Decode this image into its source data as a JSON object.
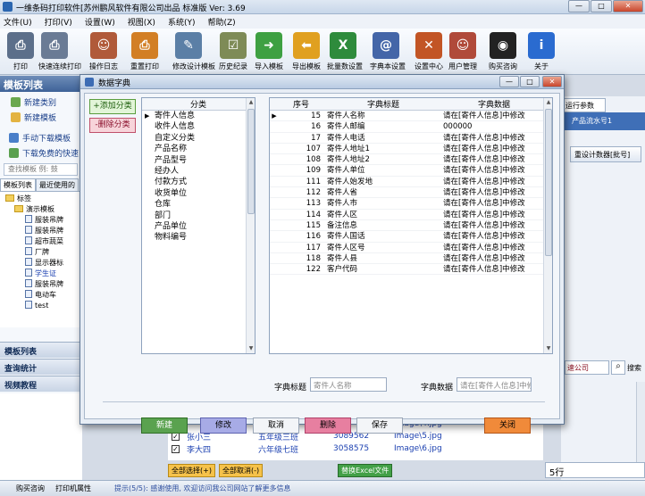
{
  "window": {
    "title": "一维条码打印软件[苏州鹏风软件有限公司出品 标准版 Ver: 3.69"
  },
  "menu": [
    "文件(U)",
    "打印(V)",
    "设置(W)",
    "视图(X)",
    "系统(Y)",
    "帮助(Z)"
  ],
  "toolbar": [
    {
      "label": "打印",
      "icon": "printer-icon",
      "color": "#5c6f8a"
    },
    {
      "label": "快速连续打印",
      "icon": "fast-print-icon",
      "color": "#6a7b95"
    },
    {
      "label": "操作日志",
      "icon": "users-log-icon",
      "color": "#b05a3a"
    },
    {
      "label": "重置打印",
      "icon": "reset-print-icon",
      "color": "#d27f25"
    },
    {
      "label": "修改设计模板",
      "icon": "design-tools-icon",
      "color": "#5b7fa6"
    },
    {
      "label": "历史纪录",
      "icon": "clipboard-history-icon",
      "color": "#7e8b57"
    },
    {
      "label": "导入模板",
      "icon": "import-arrow-icon",
      "color": "#3ea042"
    },
    {
      "label": "导出模板",
      "icon": "export-arrow-icon",
      "color": "#e0a020"
    },
    {
      "label": "批量数设置",
      "icon": "excel-icon",
      "color": "#2e8b3c"
    },
    {
      "label": "字典本设置",
      "icon": "address-book-icon",
      "color": "#4466a8"
    },
    {
      "label": "设置中心",
      "icon": "tools-icon",
      "color": "#c25525"
    },
    {
      "label": "用户管理",
      "icon": "user-manage-icon",
      "color": "#b04a3a"
    },
    {
      "label": "购买咨询",
      "icon": "qq-penguin-icon",
      "color": "#222222"
    },
    {
      "label": "关于",
      "icon": "info-icon",
      "color": "#2a6bd0"
    }
  ],
  "left": {
    "title": "模板列表",
    "actions": [
      "新建类别",
      "新建模板"
    ],
    "links": [
      "手动下载模板",
      "下载免费的快速"
    ],
    "search_placeholder": "查找模板 例: 鼓",
    "tabs": [
      "模板列表",
      "最近使用的"
    ],
    "tree": [
      {
        "text": "标签",
        "level": 1,
        "type": "folder"
      },
      {
        "text": "演示模板",
        "level": 2,
        "type": "folder"
      },
      {
        "text": "服装吊牌",
        "level": 3,
        "type": "doc"
      },
      {
        "text": "服装吊牌",
        "level": 3,
        "type": "doc"
      },
      {
        "text": "超市蔬菜",
        "level": 3,
        "type": "doc"
      },
      {
        "text": "厂牌",
        "level": 3,
        "type": "doc"
      },
      {
        "text": "显示器标",
        "level": 3,
        "type": "doc"
      },
      {
        "text": "学生证",
        "level": 3,
        "type": "doc"
      },
      {
        "text": "服装吊牌",
        "level": 3,
        "type": "doc"
      },
      {
        "text": "电动车",
        "level": 3,
        "type": "doc"
      },
      {
        "text": "test",
        "level": 3,
        "type": "doc"
      }
    ],
    "sections": [
      "模板列表",
      "查询统计",
      "视频教程"
    ]
  },
  "right": {
    "tab": "运行参数",
    "highlight": "产品流水号1",
    "button": "重设计数器[批号]",
    "company_sel": "速公司",
    "search_label": "搜索"
  },
  "background_table": {
    "rows": [
      {
        "name": "",
        "class": "",
        "id": "",
        "image": "Image\\4.jpg"
      },
      {
        "name": "张小三",
        "class": "五年级三班",
        "id": "3089562",
        "image": "Image\\5.jpg"
      },
      {
        "name": "李大四",
        "class": "六年级七班",
        "id": "3058575",
        "image": "Image\\6.jpg"
      }
    ],
    "select_all": "全部选择(+)",
    "cancel_all": "全部取消(-)",
    "replace_excel": "替换Excel文件",
    "count": "5行"
  },
  "statusbar": {
    "buy": "购买咨询",
    "print_props": "打印机属性",
    "tip": "提示(5/5): 感谢使用, 欢迎访问我公司网站了解更多信息"
  },
  "dialog": {
    "title": "数据字典",
    "add_category": "+添加分类",
    "delete_category": "-删除分类",
    "category_header": "分类",
    "categories": [
      "寄件人信息",
      "收件人信息",
      "自定义分类",
      "产品名称",
      "产品型号",
      "经办人",
      "付款方式",
      "收货单位",
      "仓库",
      "部门",
      "产品单位",
      "物料编号"
    ],
    "dict_columns": [
      "序号",
      "字典标题",
      "字典数据"
    ],
    "dict_rows": [
      {
        "no": "15",
        "title": "寄件人名称",
        "data": "请在[寄件人信息]中修改"
      },
      {
        "no": "16",
        "title": "寄件人邮编",
        "data": "000000"
      },
      {
        "no": "17",
        "title": "寄件人电话",
        "data": "请在[寄件人信息]中修改"
      },
      {
        "no": "107",
        "title": "寄件人地址1",
        "data": "请在[寄件人信息]中修改"
      },
      {
        "no": "108",
        "title": "寄件人地址2",
        "data": "请在[寄件人信息]中修改"
      },
      {
        "no": "109",
        "title": "寄件人单位",
        "data": "请在[寄件人信息]中修改"
      },
      {
        "no": "111",
        "title": "寄件人始发地",
        "data": "请在[寄件人信息]中修改"
      },
      {
        "no": "112",
        "title": "寄件人省",
        "data": "请在[寄件人信息]中修改"
      },
      {
        "no": "113",
        "title": "寄件人市",
        "data": "请在[寄件人信息]中修改"
      },
      {
        "no": "114",
        "title": "寄件人区",
        "data": "请在[寄件人信息]中修改"
      },
      {
        "no": "115",
        "title": "备注信息",
        "data": "请在[寄件人信息]中修改"
      },
      {
        "no": "116",
        "title": "寄件人国话",
        "data": "请在[寄件人信息]中修改"
      },
      {
        "no": "117",
        "title": "寄件人区号",
        "data": "请在[寄件人信息]中修改"
      },
      {
        "no": "118",
        "title": "寄件人县",
        "data": "请在[寄件人信息]中修改"
      },
      {
        "no": "122",
        "title": "客户代码",
        "data": "请在[寄件人信息]中修改"
      }
    ],
    "field_title_label": "字典标题",
    "field_title_value": "寄件人名称",
    "field_data_label": "字典数据",
    "field_data_value": "请在[寄件人信息]中修",
    "buttons": {
      "new": "新建",
      "edit": "修改",
      "cancel": "取消",
      "delete": "删除",
      "save": "保存",
      "close": "关闭"
    }
  }
}
